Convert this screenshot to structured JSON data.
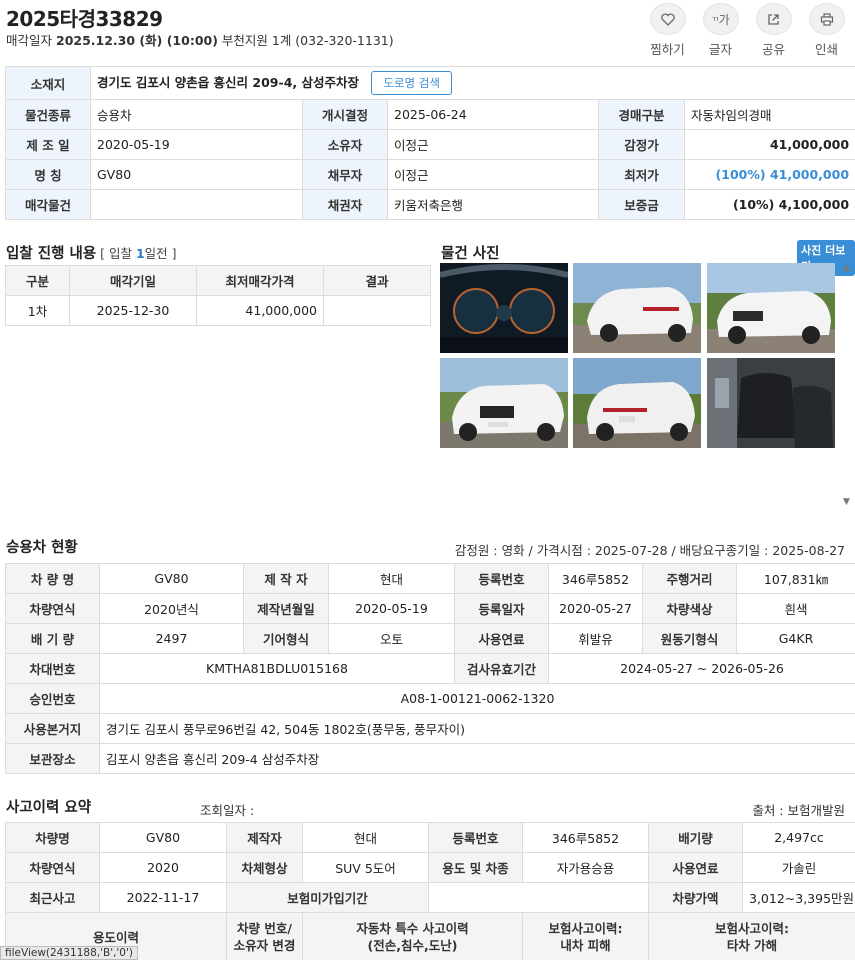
{
  "header": {
    "case_no": "2025타경33829",
    "sale_label": "매각일자",
    "sale_date": "2025.12.30 (화) (10:00)",
    "court": "부천지원 1계 (032-320-1131)"
  },
  "actions": [
    {
      "label": "찜하기",
      "icon": "heart-icon",
      "glyph": "♡"
    },
    {
      "label": "글자",
      "icon": "font-size-icon",
      "glyph": "가"
    },
    {
      "label": "공유",
      "icon": "share-icon",
      "glyph": "⇱"
    },
    {
      "label": "인쇄",
      "icon": "print-icon",
      "glyph": "⎙"
    }
  ],
  "summary": {
    "loc_label": "소재지",
    "loc_value": "경기도 김포시 양촌읍 흥신리 209-4, 삼성주차장",
    "road_btn": "도로명 검색",
    "rows": [
      [
        "물건종류",
        "승용차",
        "개시결정",
        "2025-06-24",
        "경매구분",
        "자동차임의경매"
      ],
      [
        "제 조 일",
        "2020-05-19",
        "소유자",
        "이정근",
        "감정가",
        "41,000,000"
      ],
      [
        "명 칭",
        "GV80",
        "채무자",
        "이정근",
        "최저가",
        "(100%) 41,000,000"
      ],
      [
        "매각물건",
        "",
        "채권자",
        "키움저축은행",
        "보증금",
        "(10%) 4,100,000"
      ]
    ]
  },
  "bid": {
    "title": "입찰 진행 내용",
    "note_pre": "[ 입찰 ",
    "note_num": "1",
    "note_post": "일전 ]",
    "headers": [
      "구분",
      "매각기일",
      "최저매각가격",
      "결과"
    ],
    "rows": [
      [
        "1차",
        "2025-12-30",
        "41,000,000",
        ""
      ]
    ]
  },
  "photos": {
    "title": "물건 사진",
    "more_btn": "사진 더보기"
  },
  "car": {
    "title": "승용차 현황",
    "meta": "감정원 : 영화 / 가격시점 : 2025-07-28 / 배당요구종기일 : 2025-08-27",
    "rows8": [
      [
        "차 량 명",
        "GV80",
        "제 작 자",
        "현대",
        "등록번호",
        "346루5852",
        "주행거리",
        "107,831㎞"
      ],
      [
        "차량연식",
        "2020년식",
        "제작년월일",
        "2020-05-19",
        "등록일자",
        "2020-05-27",
        "차량색상",
        "흰색"
      ],
      [
        "배 기 량",
        "2497",
        "기어형식",
        "오토",
        "사용연료",
        "휘발유",
        "원동기형식",
        "G4KR"
      ]
    ],
    "vin_label": "차대번호",
    "vin": "KMTHA81BDLU015168",
    "insp_label": "검사유효기간",
    "insp": "2024-05-27 ~ 2026-05-26",
    "approval_label": "승인번호",
    "approval": "A08-1-00121-0062-1320",
    "home_label": "사용본거지",
    "home": "경기도 김포시 풍무로96번길 42, 504동 1802호(풍무동, 풍무자이)",
    "storage_label": "보관장소",
    "storage": "김포시 양촌읍 흥신리 209-4 삼성주차장"
  },
  "accident": {
    "title": "사고이력 요약",
    "query_date": "조회일자 :",
    "source": "출처 : 보험개발원",
    "row1": [
      "차량명",
      "GV80",
      "제작자",
      "현대",
      "등록번호",
      "346루5852",
      "배기량",
      "2,497cc"
    ],
    "row2": [
      "차량연식",
      "2020",
      "차체형상",
      "SUV 5도어",
      "용도 및 차종",
      "자가용승용",
      "사용연료",
      "가솔린"
    ],
    "row3": [
      "최근사고",
      "2022-11-17",
      "보험미가입기간",
      "",
      "차량가액",
      "3,012~3,395만원"
    ],
    "row4": {
      "usage": "용도이력",
      "change_1": "차량 번호/",
      "change_2": "소유자 변경",
      "special_1": "자동차 특수 사고이력",
      "special_2": "(전손,침수,도난)",
      "mine_1": "보험사고이력:",
      "mine_2": "내차 피해",
      "other_1": "보험사고이력:",
      "other_2": "타차 가해"
    }
  },
  "statusbar": "fileView(2431188,'B','0')"
}
